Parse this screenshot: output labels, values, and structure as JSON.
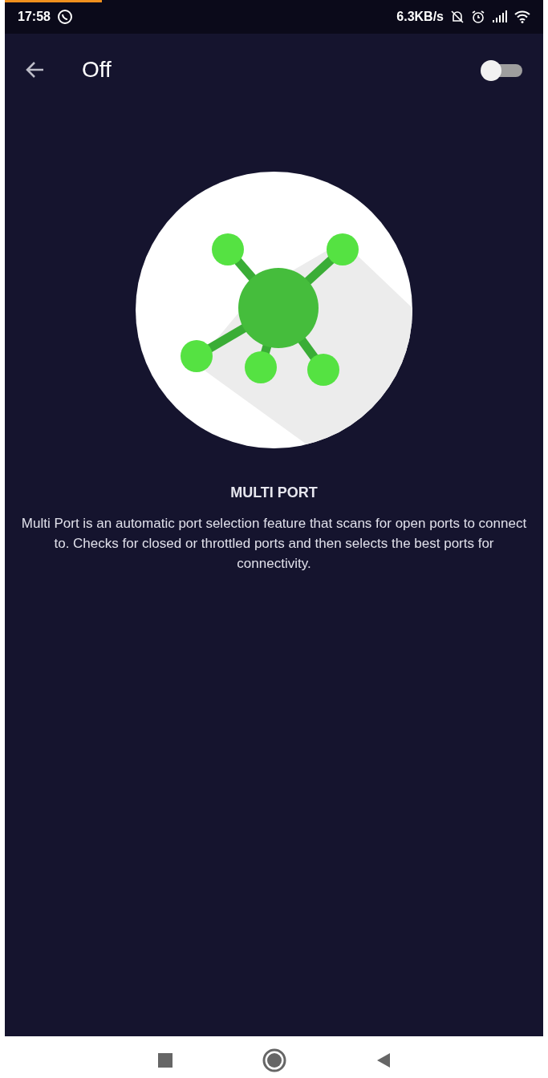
{
  "status_bar": {
    "time": "17:58",
    "net_speed": "6.3KB/s",
    "progress": {
      "level": 0.18
    }
  },
  "app_bar": {
    "title": "Off",
    "switch": {
      "on": false
    }
  },
  "feature": {
    "title": "MULTI PORT",
    "description": "Multi Port is an automatic port selection feature that scans for open ports to connect to. Checks for closed or throttled ports and then selects the best ports for connectivity."
  }
}
